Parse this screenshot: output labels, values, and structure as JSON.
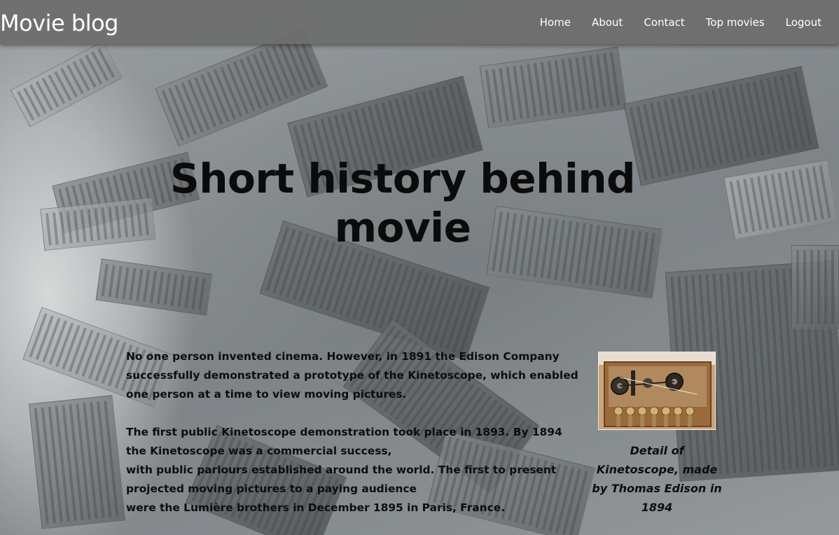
{
  "navbar": {
    "brand": "Movie blog",
    "links": [
      "Home",
      "About",
      "Contact",
      "Top movies",
      "Logout"
    ]
  },
  "hero": {
    "title": "Short history behind movie"
  },
  "article": {
    "paragraph1": "No one person invented cinema. However, in 1891 the Edison Company successfully demonstrated a prototype of the Kinetoscope, which enabled one person at a time to view moving pictures.",
    "paragraph2_lines": [
      "The first public Kinetoscope demonstration took place in 1893. By 1894 the Kinetoscope was a commercial success,",
      "with public parlours established around the world. The first to present projected moving pictures to a paying audience",
      "were the Lumière brothers in December 1895 in Paris, France."
    ]
  },
  "figure": {
    "image_subject": "kinetoscope-mechanism",
    "caption": "Detail of Kinetoscope, made by Thomas Edison in 1894"
  },
  "colors": {
    "navbar_bg": "#6e6e6e",
    "nav_text": "#ffffff",
    "body_text": "#0d0d0d"
  }
}
